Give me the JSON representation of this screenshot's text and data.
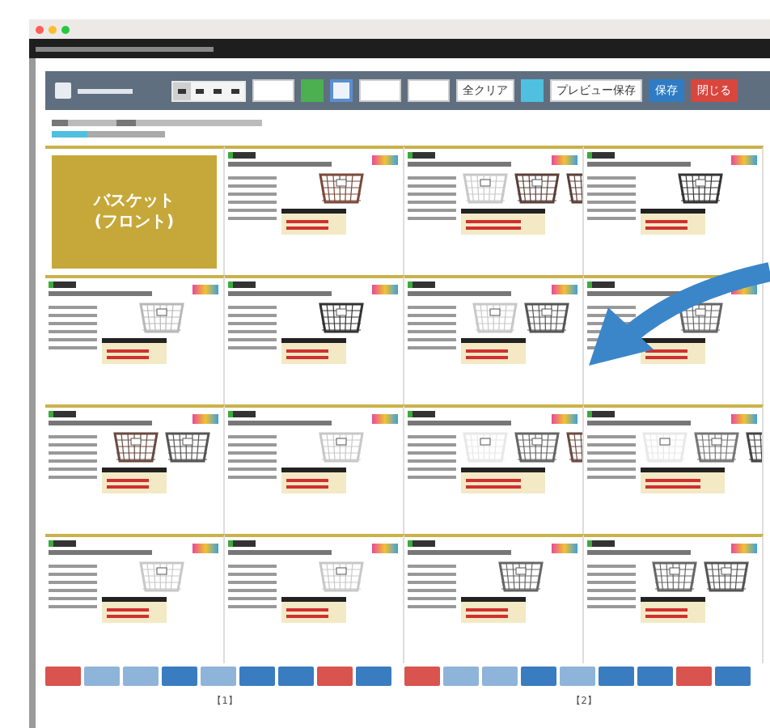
{
  "segments": [
    {
      "selected": true
    },
    {
      "selected": false
    },
    {
      "selected": false
    },
    {
      "selected": false
    }
  ],
  "toolbar_buttons": [
    {
      "kind": "white"
    },
    {
      "kind": "green"
    },
    {
      "kind": "outlined"
    },
    {
      "kind": "white"
    },
    {
      "kind": "white"
    },
    {
      "kind": "white",
      "label": "全クリア"
    },
    {
      "kind": "cyan"
    },
    {
      "kind": "white",
      "label": "プレビュー保存"
    },
    {
      "kind": "blue",
      "label": "保存"
    },
    {
      "kind": "red",
      "label": "閉じる"
    }
  ],
  "pages": [
    {
      "number": "【1】",
      "cards": [
        {
          "kind": "category",
          "label": "バスケット\n(フロント)"
        },
        {
          "kind": "product",
          "baskets": [
            {
              "color": "#7a4a3a"
            }
          ]
        },
        {
          "kind": "product",
          "baskets": [
            {
              "color": "#b8b8b8"
            }
          ]
        },
        {
          "kind": "product",
          "baskets": [
            {
              "color": "#333333"
            }
          ]
        },
        {
          "kind": "product",
          "baskets": [
            {
              "color": "#6b4a40"
            },
            {
              "color": "#555555"
            }
          ]
        },
        {
          "kind": "product",
          "baskets": [
            {
              "color": "#c8c8c8"
            }
          ]
        },
        {
          "kind": "product",
          "baskets": [
            {
              "color": "#c8c8c8"
            }
          ]
        },
        {
          "kind": "product",
          "baskets": [
            {
              "color": "#c8c8c8"
            }
          ]
        }
      ],
      "actions": [
        {
          "color": "#d9534f"
        },
        {
          "color": "#8fb4d9"
        },
        {
          "color": "#8fb4d9"
        },
        {
          "color": "#3a7cc0"
        },
        {
          "color": "#8fb4d9"
        },
        {
          "color": "#3a7cc0"
        },
        {
          "color": "#3a7cc0"
        },
        {
          "color": "#d9534f"
        },
        {
          "color": "#3a7cc0"
        }
      ]
    },
    {
      "number": "【2】",
      "cards": [
        {
          "kind": "product",
          "baskets": [
            {
              "color": "#c8c8c8"
            },
            {
              "color": "#5a4038"
            },
            {
              "color": "#5a4038"
            }
          ]
        },
        {
          "kind": "product",
          "baskets": [
            {
              "color": "#333333"
            }
          ]
        },
        {
          "kind": "product",
          "baskets": [
            {
              "color": "#c8c8c8"
            },
            {
              "color": "#555555"
            }
          ]
        },
        {
          "kind": "product",
          "baskets": [
            {
              "color": "#666666"
            }
          ]
        },
        {
          "kind": "product",
          "baskets": [
            {
              "color": "#e8e8e8"
            },
            {
              "color": "#666666"
            },
            {
              "color": "#6b4a40"
            }
          ]
        },
        {
          "kind": "product",
          "baskets": [
            {
              "color": "#e8e8e8"
            },
            {
              "color": "#777777"
            },
            {
              "color": "#444444"
            }
          ]
        },
        {
          "kind": "product",
          "baskets": [
            {
              "color": "#666666"
            }
          ]
        },
        {
          "kind": "product",
          "baskets": [
            {
              "color": "#666666"
            },
            {
              "color": "#555555"
            }
          ]
        }
      ],
      "actions": [
        {
          "color": "#d9534f"
        },
        {
          "color": "#8fb4d9"
        },
        {
          "color": "#8fb4d9"
        },
        {
          "color": "#3a7cc0"
        },
        {
          "color": "#8fb4d9"
        },
        {
          "color": "#3a7cc0"
        },
        {
          "color": "#3a7cc0"
        },
        {
          "color": "#d9534f"
        },
        {
          "color": "#3a7cc0"
        }
      ]
    }
  ]
}
